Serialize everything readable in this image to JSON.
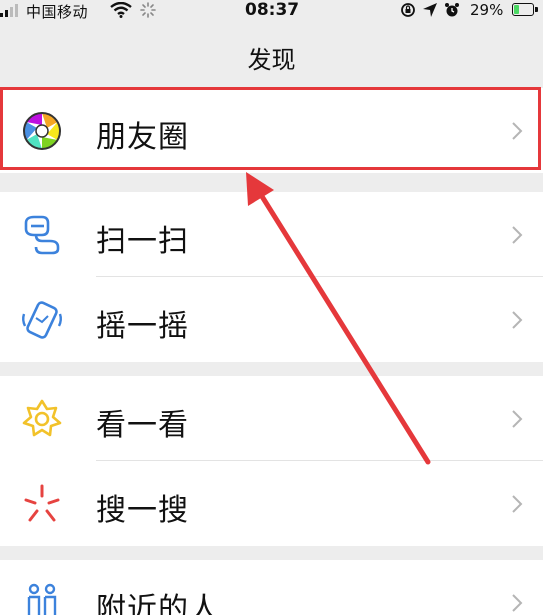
{
  "status_bar": {
    "carrier": "中国移动",
    "time": "08:37",
    "battery_percent": "29%",
    "battery_level": 0.29,
    "icons": [
      "signal-icon",
      "wifi-icon",
      "loading-icon",
      "orientation-lock-icon",
      "location-icon",
      "alarm-icon",
      "battery-icon"
    ]
  },
  "nav": {
    "title": "发现"
  },
  "items": [
    {
      "id": "moments",
      "label": "朋友圈",
      "icon": "moments-icon"
    },
    {
      "id": "scan",
      "label": "扫一扫",
      "icon": "scan-icon"
    },
    {
      "id": "shake",
      "label": "摇一摇",
      "icon": "shake-icon"
    },
    {
      "id": "top-stories",
      "label": "看一看",
      "icon": "top-stories-icon"
    },
    {
      "id": "search",
      "label": "搜一搜",
      "icon": "search-icon"
    },
    {
      "id": "nearby",
      "label": "附近的人",
      "icon": "people-nearby-icon"
    }
  ],
  "colors": {
    "background": "#ededed",
    "highlight": "#e5383b",
    "scan_blue": "#3c82dc",
    "star_yellow": "#f2c22a",
    "search_red": "#e64340"
  }
}
